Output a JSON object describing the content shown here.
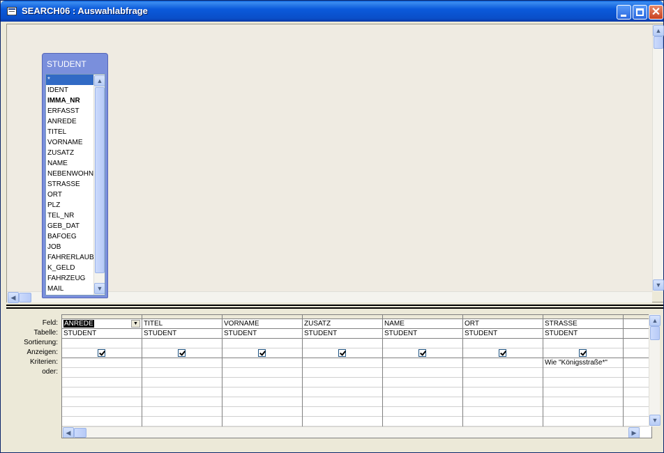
{
  "window": {
    "title": "SEARCH06 : Auswahlabfrage"
  },
  "table": {
    "name": "STUDENT",
    "fields": [
      "*",
      "IDENT",
      "IMMA_NR",
      "ERFASST",
      "ANREDE",
      "TITEL",
      "VORNAME",
      "ZUSATZ",
      "NAME",
      "NEBENWOHN",
      "STRASSE",
      "ORT",
      "PLZ",
      "TEL_NR",
      "GEB_DAT",
      "BAFOEG",
      "JOB",
      "FAHRERLAUB",
      "K_GELD",
      "FAHRZEUG",
      "MAIL"
    ],
    "selected_field": "*",
    "bold_field": "IMMA_NR"
  },
  "grid": {
    "row_labels": {
      "feld": "Feld:",
      "tabelle": "Tabelle:",
      "sortierung": "Sortierung:",
      "anzeigen": "Anzeigen:",
      "kriterien": "Kriterien:",
      "oder": "oder:"
    },
    "columns": [
      {
        "feld": "ANREDE",
        "tabelle": "STUDENT",
        "sortierung": "",
        "anzeigen": true,
        "kriterien": "",
        "oder": ""
      },
      {
        "feld": "TITEL",
        "tabelle": "STUDENT",
        "sortierung": "",
        "anzeigen": true,
        "kriterien": "",
        "oder": ""
      },
      {
        "feld": "VORNAME",
        "tabelle": "STUDENT",
        "sortierung": "",
        "anzeigen": true,
        "kriterien": "",
        "oder": ""
      },
      {
        "feld": "ZUSATZ",
        "tabelle": "STUDENT",
        "sortierung": "",
        "anzeigen": true,
        "kriterien": "",
        "oder": ""
      },
      {
        "feld": "NAME",
        "tabelle": "STUDENT",
        "sortierung": "",
        "anzeigen": true,
        "kriterien": "",
        "oder": ""
      },
      {
        "feld": "ORT",
        "tabelle": "STUDENT",
        "sortierung": "",
        "anzeigen": true,
        "kriterien": "",
        "oder": ""
      },
      {
        "feld": "STRASSE",
        "tabelle": "STUDENT",
        "sortierung": "",
        "anzeigen": true,
        "kriterien": "Wie \"Königsstraße*\"",
        "oder": ""
      },
      {
        "feld": "",
        "tabelle": "",
        "sortierung": "",
        "anzeigen": false,
        "kriterien": "",
        "oder": ""
      }
    ],
    "active_column": 0
  },
  "icons": {
    "up": "▲",
    "down": "▼",
    "left": "◀",
    "right": "▶",
    "grip": "≡",
    "dropdown": "▼",
    "close": "✕"
  }
}
